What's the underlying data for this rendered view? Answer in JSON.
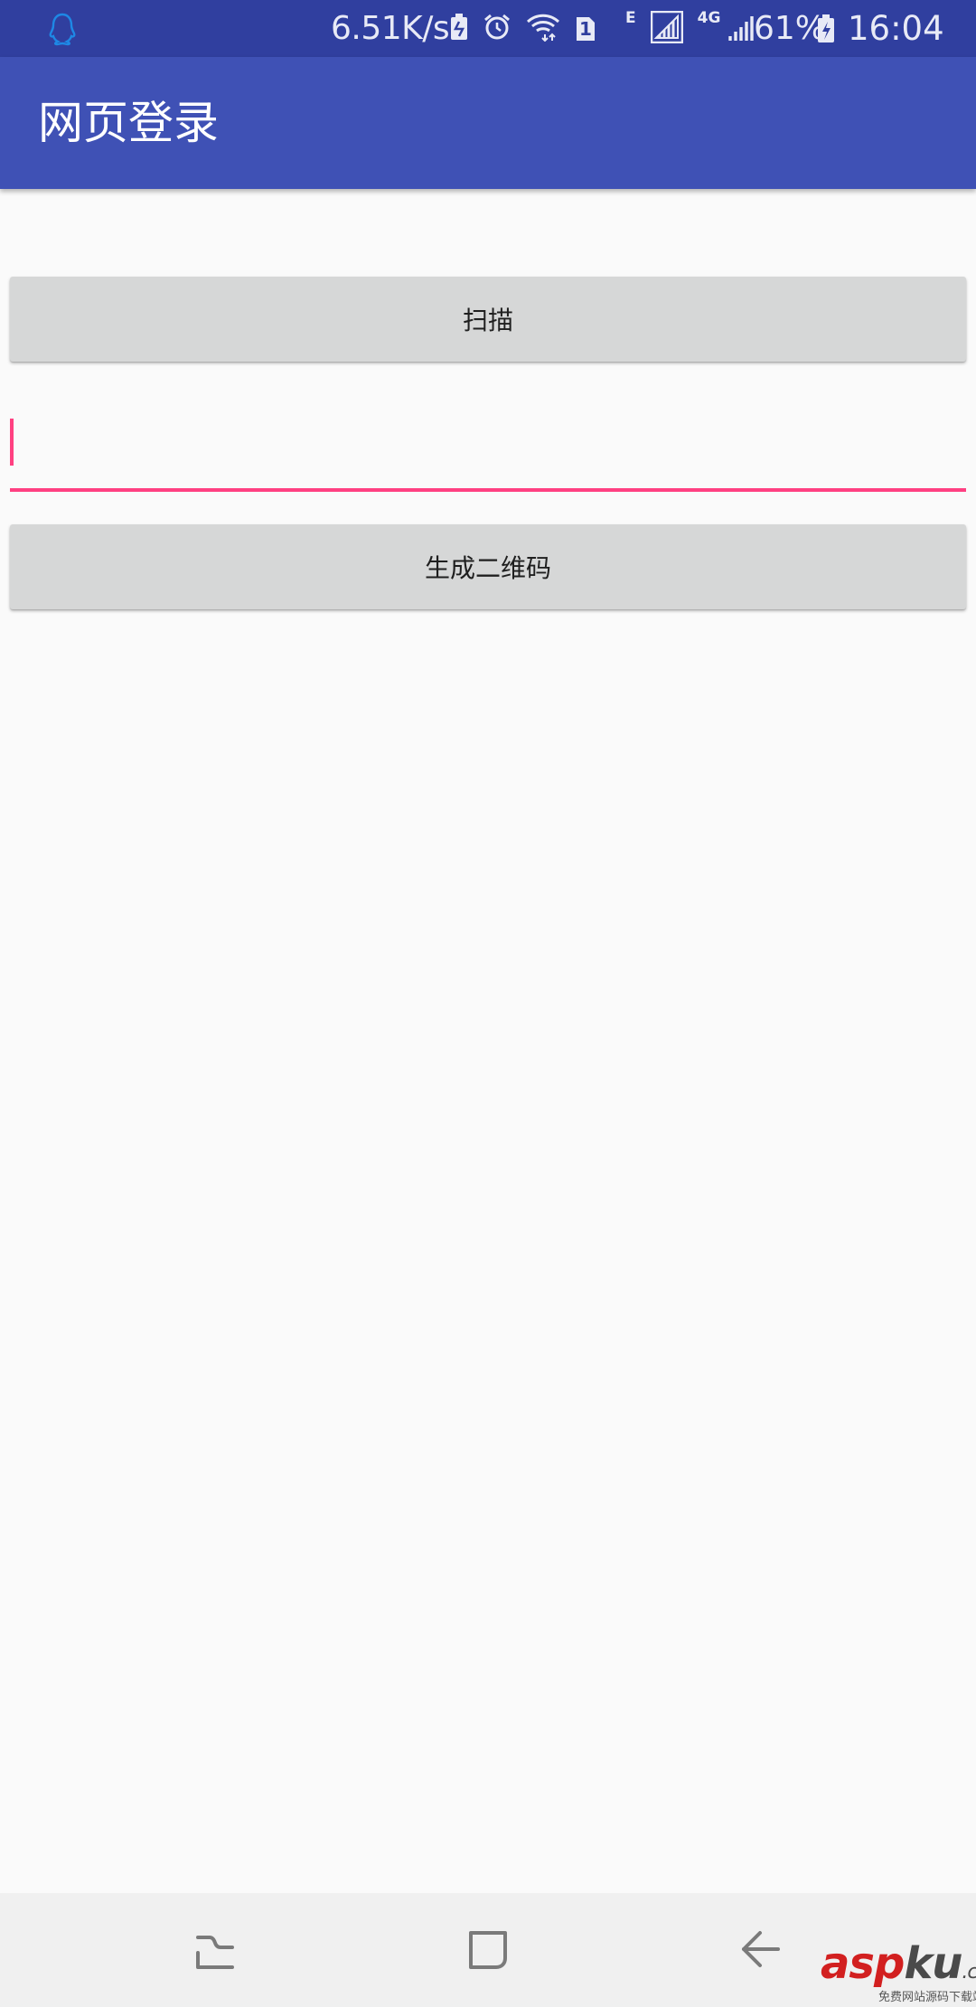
{
  "status_bar": {
    "network_speed": "6.51K/s",
    "sim_label": "1",
    "edge_label": "E",
    "network_type": "4G",
    "battery_percent": "61%",
    "time": "16:04",
    "icons": [
      "qq-penguin-icon",
      "battery-saver-icon",
      "alarm-icon",
      "wifi-icon",
      "sim1-icon",
      "signal-icon",
      "signal-icon",
      "battery-charging-icon"
    ]
  },
  "app_bar": {
    "title": "网页登录"
  },
  "main": {
    "scan_button_label": "扫描",
    "input": {
      "value": "",
      "placeholder": ""
    },
    "generate_button_label": "生成二维码"
  },
  "nav_bar": {
    "buttons": [
      "recents",
      "home",
      "back"
    ]
  },
  "watermark": {
    "logo_asp": "asp",
    "logo_ku": "ku",
    "logo_com": ".com",
    "subtitle": "免费网站源码下载站!"
  },
  "colors": {
    "status_bar": "#303f9f",
    "primary": "#3f51b5",
    "accent": "#ff4081",
    "button_bg": "#d6d7d7",
    "background": "#fafafa",
    "nav_bar": "#f0f0f0"
  }
}
